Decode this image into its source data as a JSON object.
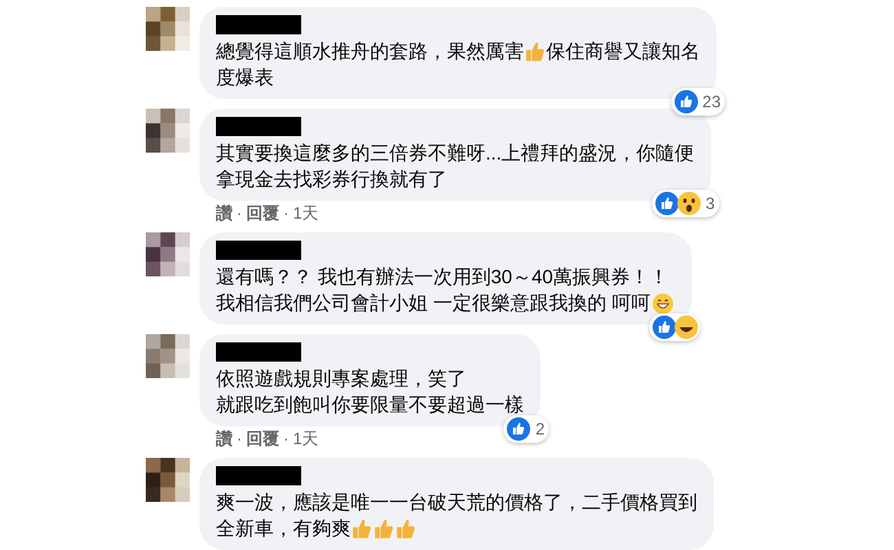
{
  "comments": [
    {
      "lines": [
        [
          {
            "kind": "text",
            "text": "總覺得這順水推舟的套路，果然厲害"
          },
          {
            "kind": "thumb"
          },
          {
            "kind": "text",
            "text": "保住商譽又讓知名"
          }
        ],
        [
          {
            "kind": "text",
            "text": "度爆表"
          }
        ]
      ],
      "reactions": {
        "icons": [
          {
            "kind": "like"
          }
        ],
        "count": "23"
      }
    },
    {
      "lines": [
        [
          {
            "kind": "text",
            "text": "其實要換這麼多的三倍券不難呀...上禮拜的盛況，你隨便"
          }
        ],
        [
          {
            "kind": "text",
            "text": "拿現金去找彩券行換就有了"
          }
        ]
      ],
      "reactions": {
        "icons": [
          {
            "kind": "like"
          },
          {
            "kind": "wow"
          }
        ],
        "count": "3"
      },
      "actions": [
        {
          "kind": "link",
          "text": "讚"
        },
        {
          "kind": "sep",
          "text": "·"
        },
        {
          "kind": "link",
          "text": "回覆"
        },
        {
          "kind": "sep",
          "text": "·"
        },
        {
          "kind": "time",
          "text": "1天"
        }
      ]
    },
    {
      "lines": [
        [
          {
            "kind": "text",
            "text": "還有嗎？？ 我也有辦法一次用到30～40萬振興券！！"
          }
        ],
        [
          {
            "kind": "text",
            "text": "我相信我們公司會計小姐 一定很樂意跟我換的 呵呵"
          },
          {
            "kind": "grin"
          }
        ]
      ],
      "reactions": {
        "icons": [
          {
            "kind": "like"
          },
          {
            "kind": "haha"
          }
        ]
      }
    },
    {
      "lines": [
        [
          {
            "kind": "text",
            "text": "依照遊戲規則專案處理，笑了"
          }
        ],
        [
          {
            "kind": "text",
            "text": "就跟吃到飽叫你要限量不要超過一樣"
          }
        ]
      ],
      "reactions": {
        "icons": [
          {
            "kind": "like"
          }
        ],
        "count": "2"
      },
      "actions": [
        {
          "kind": "link",
          "text": "讚"
        },
        {
          "kind": "sep",
          "text": "·"
        },
        {
          "kind": "link",
          "text": "回覆"
        },
        {
          "kind": "sep",
          "text": "·"
        },
        {
          "kind": "time",
          "text": "1天"
        }
      ]
    },
    {
      "lines": [
        [
          {
            "kind": "text",
            "text": "爽一波，應該是唯一一台破天荒的價格了，二手價格買到"
          }
        ],
        [
          {
            "kind": "text",
            "text": "全新車，有夠爽"
          },
          {
            "kind": "thumb"
          },
          {
            "kind": "thumb"
          },
          {
            "kind": "thumb"
          }
        ]
      ]
    }
  ]
}
